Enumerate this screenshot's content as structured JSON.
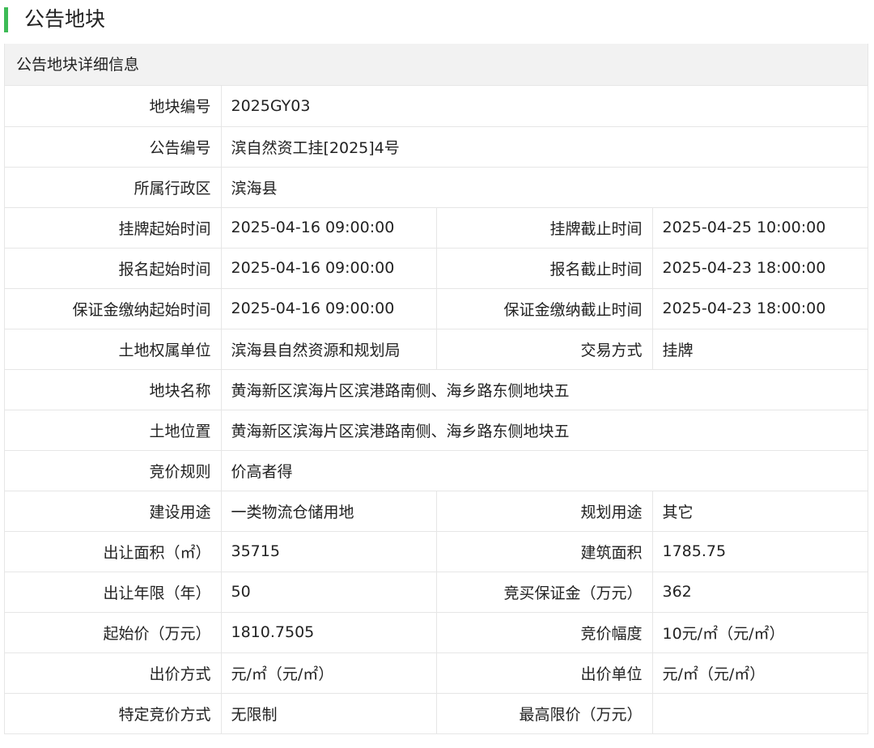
{
  "page": {
    "title": "公告地块",
    "accent_color": "#3dbb56"
  },
  "panel": {
    "title": "公告地块详细信息"
  },
  "fields": {
    "parcel_no": {
      "label": "地块编号",
      "value": "2025GY03"
    },
    "notice_no": {
      "label": "公告编号",
      "value": "滨自然资工挂[2025]4号"
    },
    "district": {
      "label": "所属行政区",
      "value": "滨海县"
    },
    "listing_start": {
      "label": "挂牌起始时间",
      "value": "2025-04-16 09:00:00"
    },
    "listing_end": {
      "label": "挂牌截止时间",
      "value": "2025-04-25 10:00:00"
    },
    "signup_start": {
      "label": "报名起始时间",
      "value": "2025-04-16 09:00:00"
    },
    "signup_end": {
      "label": "报名截止时间",
      "value": "2025-04-23 18:00:00"
    },
    "deposit_start": {
      "label": "保证金缴纳起始时间",
      "value": "2025-04-16 09:00:00"
    },
    "deposit_end": {
      "label": "保证金缴纳截止时间",
      "value": "2025-04-23 18:00:00"
    },
    "owner_unit": {
      "label": "土地权属单位",
      "value": "滨海县自然资源和规划局"
    },
    "trade_method": {
      "label": "交易方式",
      "value": "挂牌"
    },
    "parcel_name": {
      "label": "地块名称",
      "value": "黄海新区滨海片区滨港路南侧、海乡路东侧地块五"
    },
    "location": {
      "label": "土地位置",
      "value": "黄海新区滨海片区滨港路南侧、海乡路东侧地块五"
    },
    "bid_rule": {
      "label": "竞价规则",
      "value": "价高者得"
    },
    "construction_use": {
      "label": "建设用途",
      "value": "一类物流仓储用地"
    },
    "planned_use": {
      "label": "规划用途",
      "value": "其它"
    },
    "area": {
      "label": "出让面积（㎡）",
      "value": "35715"
    },
    "building_area": {
      "label": "建筑面积",
      "value": "1785.75"
    },
    "term": {
      "label": "出让年限（年）",
      "value": "50"
    },
    "bid_deposit": {
      "label": "竞买保证金（万元）",
      "value": "362"
    },
    "start_price": {
      "label": "起始价（万元）",
      "value": "1810.7505"
    },
    "bid_increment": {
      "label": "竞价幅度",
      "value": "10元/㎡（元/㎡）"
    },
    "offer_method": {
      "label": "出价方式",
      "value": "元/㎡（元/㎡）"
    },
    "offer_unit": {
      "label": "出价单位",
      "value": "元/㎡（元/㎡）"
    },
    "special_bid_method": {
      "label": "特定竞价方式",
      "value": "无限制"
    },
    "max_price": {
      "label": "最高限价（万元）",
      "value": ""
    }
  }
}
